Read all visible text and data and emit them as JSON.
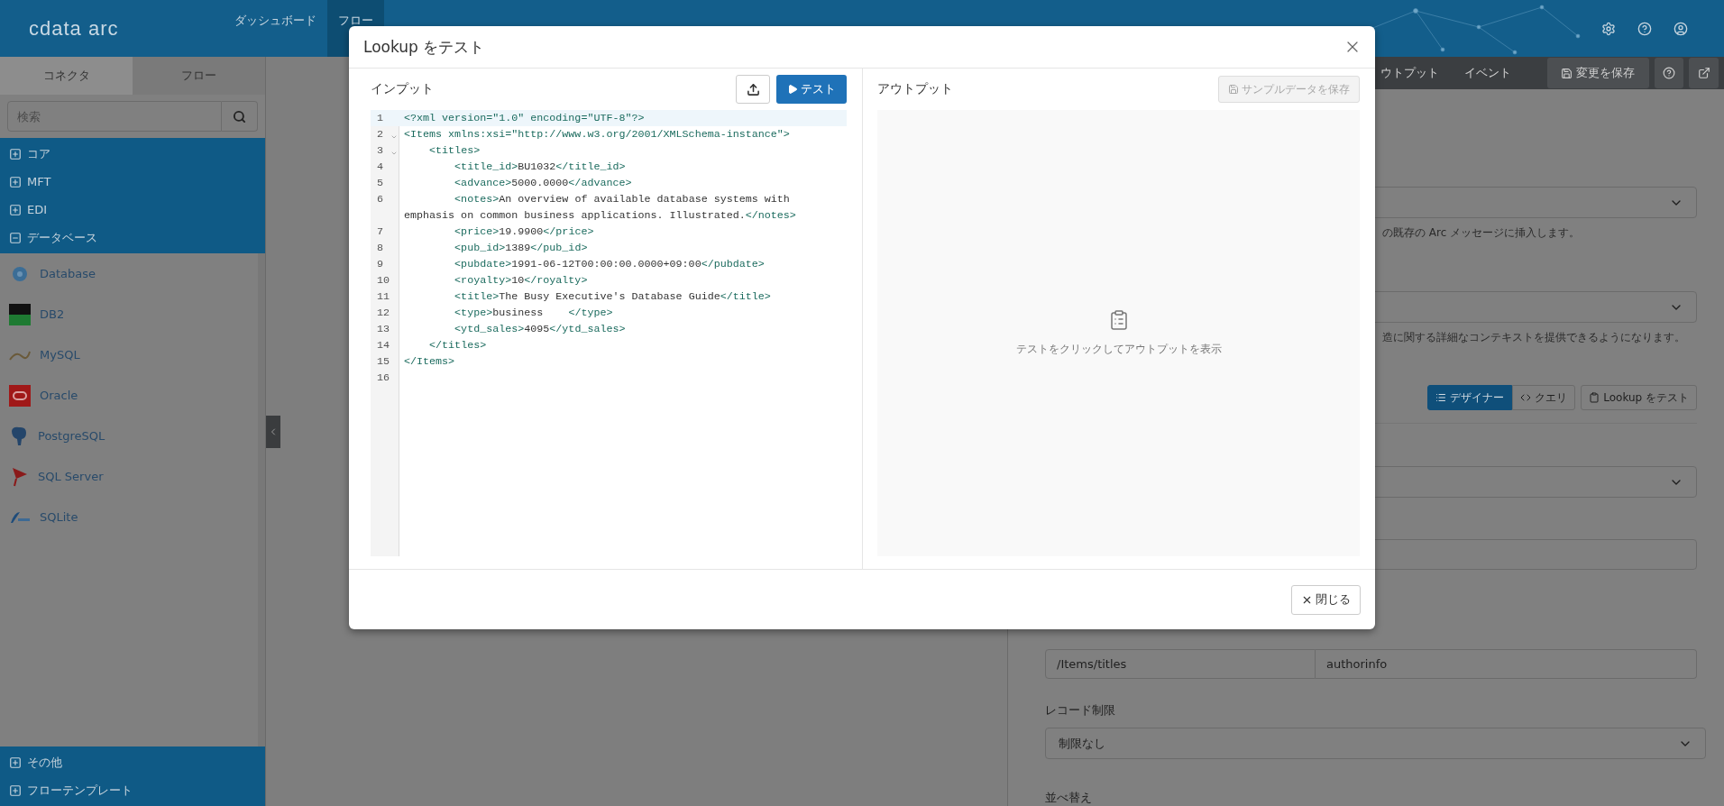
{
  "nav": {
    "logo": "cdata arc",
    "items": [
      {
        "label": "ダッシュボード",
        "selected": false
      },
      {
        "label": "フロー",
        "selected": true
      }
    ]
  },
  "sidebar": {
    "tabs": [
      {
        "label": "コネクタ",
        "selected": true
      },
      {
        "label": "フロー",
        "selected": false
      }
    ],
    "search": {
      "placeholder": "検索"
    },
    "categories": [
      {
        "label": "コア",
        "expanded": false
      },
      {
        "label": "MFT",
        "expanded": false
      },
      {
        "label": "EDI",
        "expanded": false
      },
      {
        "label": "データベース",
        "expanded": true,
        "children": [
          {
            "label": "Database",
            "kind": "database"
          },
          {
            "label": "DB2",
            "kind": "db2"
          },
          {
            "label": "MySQL",
            "kind": "mysql"
          },
          {
            "label": "Oracle",
            "kind": "oracle"
          },
          {
            "label": "PostgreSQL",
            "kind": "postgresql"
          },
          {
            "label": "SQL Server",
            "kind": "sqlserver"
          },
          {
            "label": "SQLite",
            "kind": "sqlite"
          }
        ]
      }
    ],
    "bottom_categories": [
      {
        "label": "その他",
        "expanded": false
      },
      {
        "label": "フローテンプレート",
        "expanded": false
      }
    ]
  },
  "toolbar": {
    "tabs": [
      {
        "label": "ウトプット"
      },
      {
        "label": "イベント"
      }
    ],
    "save_button": "変更を保存"
  },
  "panel": {
    "help_1": "の既存の Arc メッセージに挿入します。",
    "help_2": "造に関する詳細なコンテキストを提供できるようになります。",
    "modes": [
      {
        "label": "デザイナー",
        "selected": true
      },
      {
        "label": "クエリ",
        "selected": false
      }
    ],
    "test_button": "Lookup をテスト",
    "path_field": {
      "value": "/Items/titles"
    },
    "name_field": {
      "value": "authorinfo"
    },
    "record_limit": {
      "label": "レコード制限",
      "value": "制限なし"
    },
    "sort_label": "並べ替え"
  },
  "modal": {
    "title": "Lookup をテスト",
    "input": {
      "title": "インプット",
      "test_button": "テスト",
      "lines": [
        {
          "number": "1",
          "text": "<?xml version=\"1.0\" encoding=\"UTF-8\"?>",
          "foldable": false,
          "active": true
        },
        {
          "number": "2",
          "text": "<Items xmlns:xsi=\"http://www.w3.org/2001/XMLSchema-instance\">",
          "foldable": true,
          "active": false
        },
        {
          "number": "3",
          "text": "    <titles>",
          "foldable": true,
          "active": false
        },
        {
          "number": "4",
          "text": "        <title_id>BU1032</title_id>",
          "foldable": false,
          "active": false
        },
        {
          "number": "5",
          "text": "        <advance>5000.0000</advance>",
          "foldable": false,
          "active": false
        },
        {
          "number": "6",
          "text": "        <notes>An overview of available database systems with emphasis on common business applications. Illustrated.</notes>",
          "foldable": false,
          "active": false
        },
        {
          "number": "7",
          "text": "        <price>19.9900</price>",
          "foldable": false,
          "active": false
        },
        {
          "number": "8",
          "text": "        <pub_id>1389</pub_id>",
          "foldable": false,
          "active": false
        },
        {
          "number": "9",
          "text": "        <pubdate>1991-06-12T00:00:00.0000+09:00</pubdate>",
          "foldable": false,
          "active": false
        },
        {
          "number": "10",
          "text": "        <royalty>10</royalty>",
          "foldable": false,
          "active": false
        },
        {
          "number": "11",
          "text": "        <title>The Busy Executive's Database Guide</title>",
          "foldable": false,
          "active": false
        },
        {
          "number": "12",
          "text": "        <type>business    </type>",
          "foldable": false,
          "active": false
        },
        {
          "number": "13",
          "text": "        <ytd_sales>4095</ytd_sales>",
          "foldable": false,
          "active": false
        },
        {
          "number": "14",
          "text": "    </titles>",
          "foldable": false,
          "active": false
        },
        {
          "number": "15",
          "text": "</Items>",
          "foldable": false,
          "active": false
        },
        {
          "number": "16",
          "foldable": false,
          "active": false
        }
      ]
    },
    "output": {
      "title": "アウトプット",
      "save_button": {
        "label": "サンプルデータを保存",
        "disabled": true
      },
      "empty_text": "テストをクリックしてアウトプットを表示"
    },
    "close_button": "閉じる"
  }
}
